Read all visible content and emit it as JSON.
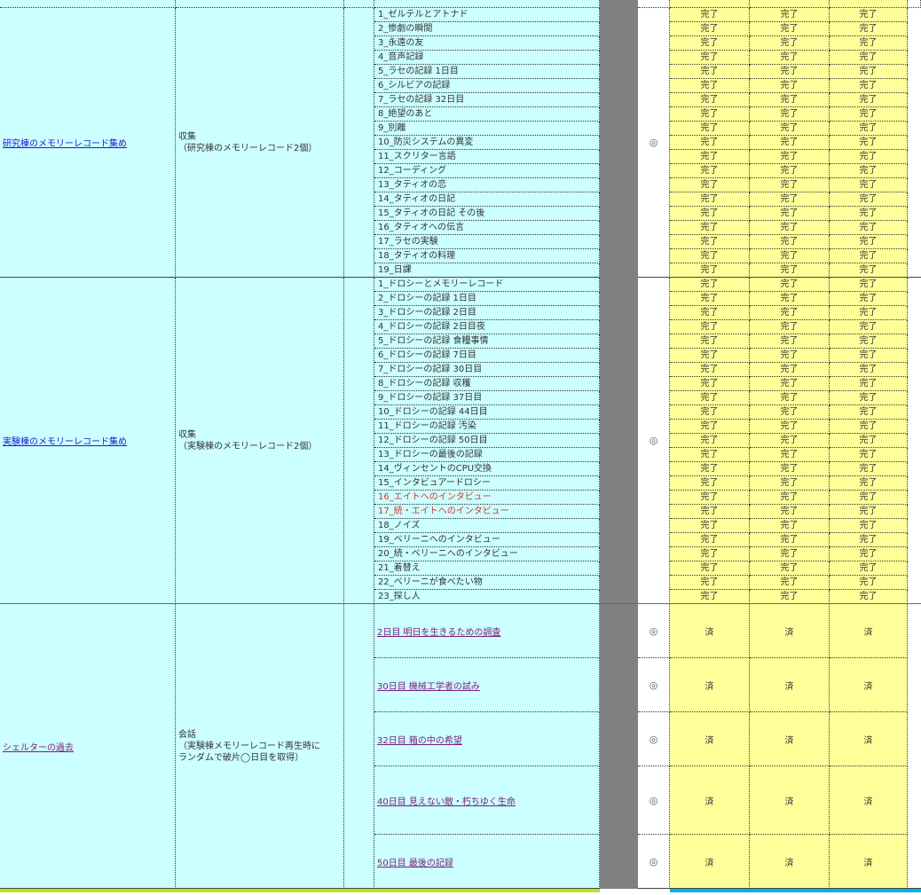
{
  "colors": {
    "cyan": "#ccffff",
    "yellow": "#ffff99",
    "grey": "#808080",
    "link_blue": "#1a1acc",
    "link_purple": "#7b1f7b",
    "highlight_red": "#d9362a",
    "bottom_lime": "#b5e61d",
    "bottom_blue": "#00b0f0",
    "section_green": "#2e8b57"
  },
  "sections": [
    {
      "category": "研究棟のメモリーレコード集め",
      "content_type": "収集\n（研究棟のメモリーレコード2個）",
      "mark": "◎",
      "items": [
        {
          "name": "1_ゼルテルとアトナド",
          "status": [
            "完了",
            "完了",
            "完了"
          ]
        },
        {
          "name": "2_惨劇の瞬間",
          "status": [
            "完了",
            "完了",
            "完了"
          ]
        },
        {
          "name": "3_永遠の友",
          "status": [
            "完了",
            "完了",
            "完了"
          ]
        },
        {
          "name": "4_音声記録",
          "status": [
            "完了",
            "完了",
            "完了"
          ]
        },
        {
          "name": "5_ラセの記録 1日目",
          "status": [
            "完了",
            "完了",
            "完了"
          ]
        },
        {
          "name": "6_シルビアの記録",
          "status": [
            "完了",
            "完了",
            "完了"
          ]
        },
        {
          "name": "7_ラセの記録 32日目",
          "status": [
            "完了",
            "完了",
            "完了"
          ]
        },
        {
          "name": "8_絶望のあと",
          "status": [
            "完了",
            "完了",
            "完了"
          ]
        },
        {
          "name": "9_別離",
          "status": [
            "完了",
            "完了",
            "完了"
          ]
        },
        {
          "name": "10_防災システムの異変",
          "status": [
            "完了",
            "完了",
            "完了"
          ]
        },
        {
          "name": "11_スクリター言語",
          "status": [
            "完了",
            "完了",
            "完了"
          ]
        },
        {
          "name": "12_コーディング",
          "status": [
            "完了",
            "完了",
            "完了"
          ]
        },
        {
          "name": "13_タティオの恋",
          "status": [
            "完了",
            "完了",
            "完了"
          ]
        },
        {
          "name": "14_タティオの日記",
          "status": [
            "完了",
            "完了",
            "完了"
          ]
        },
        {
          "name": "15_タティオの日記 その後",
          "status": [
            "完了",
            "完了",
            "完了"
          ]
        },
        {
          "name": "16_タティオへの伝言",
          "status": [
            "完了",
            "完了",
            "完了"
          ]
        },
        {
          "name": "17_ラセの実験",
          "status": [
            "完了",
            "完了",
            "完了"
          ]
        },
        {
          "name": "18_タティオの料理",
          "status": [
            "完了",
            "完了",
            "完了"
          ]
        },
        {
          "name": "19_日課",
          "status": [
            "完了",
            "完了",
            "完了"
          ]
        }
      ]
    },
    {
      "category": "実験棟のメモリーレコード集め",
      "content_type": "収集\n（実験棟のメモリーレコード2個）",
      "mark": "◎",
      "items": [
        {
          "name": "1_ドロシーとメモリーレコード",
          "status": [
            "完了",
            "完了",
            "完了"
          ]
        },
        {
          "name": "2_ドロシーの記録 1日目",
          "status": [
            "完了",
            "完了",
            "完了"
          ]
        },
        {
          "name": "3_ドロシーの記録 2日目",
          "status": [
            "完了",
            "完了",
            "完了"
          ]
        },
        {
          "name": "4_ドロシーの記録 2日目夜",
          "status": [
            "完了",
            "完了",
            "完了"
          ]
        },
        {
          "name": "5_ドロシーの記録 食糧事情",
          "status": [
            "完了",
            "完了",
            "完了"
          ]
        },
        {
          "name": "6_ドロシーの記録 7日目",
          "status": [
            "完了",
            "完了",
            "完了"
          ]
        },
        {
          "name": "7_ドロシーの記録 30日目",
          "status": [
            "完了",
            "完了",
            "完了"
          ]
        },
        {
          "name": "8_ドロシーの記録 収穫",
          "status": [
            "完了",
            "完了",
            "完了"
          ]
        },
        {
          "name": "9_ドロシーの記録 37日目",
          "status": [
            "完了",
            "完了",
            "完了"
          ]
        },
        {
          "name": "10_ドロシーの記録 44日目",
          "status": [
            "完了",
            "完了",
            "完了"
          ]
        },
        {
          "name": "11_ドロシーの記録 汚染",
          "status": [
            "完了",
            "完了",
            "完了"
          ]
        },
        {
          "name": "12_ドロシーの記録 50日目",
          "status": [
            "完了",
            "完了",
            "完了"
          ]
        },
        {
          "name": "13_ドロシーの最後の記録",
          "status": [
            "完了",
            "完了",
            "完了"
          ]
        },
        {
          "name": "14_ヴィンセントのCPU交換",
          "status": [
            "完了",
            "完了",
            "完了"
          ]
        },
        {
          "name": "15_インタビュアードロシー",
          "status": [
            "完了",
            "完了",
            "完了"
          ]
        },
        {
          "name": "16_エイトへのインタビュー",
          "status": [
            "完了",
            "完了",
            "完了"
          ],
          "highlight": true
        },
        {
          "name": "17_続・エイトへのインタビュー",
          "status": [
            "完了",
            "完了",
            "完了"
          ],
          "highlight": true
        },
        {
          "name": "18_ノイズ",
          "status": [
            "完了",
            "完了",
            "完了"
          ]
        },
        {
          "name": "19_ベリーニへのインタビュー",
          "status": [
            "完了",
            "完了",
            "完了"
          ]
        },
        {
          "name": "20_続・ベリーニへのインタビュー",
          "status": [
            "完了",
            "完了",
            "完了"
          ]
        },
        {
          "name": "21_着替え",
          "status": [
            "完了",
            "完了",
            "完了"
          ]
        },
        {
          "name": "22_ベリーニが食べたい物",
          "status": [
            "完了",
            "完了",
            "完了"
          ]
        },
        {
          "name": "23_探し人",
          "status": [
            "完了",
            "完了",
            "完了"
          ]
        }
      ]
    },
    {
      "category": "シェルターの過去",
      "content_type": "会話\n（実験棟メモリーレコード再生時に\nランダムで破片◯日目を取得）",
      "items": [
        {
          "name": "2日目 明日を生きるための調査",
          "mark": "◎",
          "status": [
            "済",
            "済",
            "済"
          ]
        },
        {
          "name": "30日目 機械工学者の試み",
          "mark": "◎",
          "status": [
            "済",
            "済",
            "済"
          ]
        },
        {
          "name": "32日目 箱の中の希望",
          "mark": "◎",
          "status": [
            "済",
            "済",
            "済"
          ]
        },
        {
          "name": "40日目 見えない敵・朽ちゆく生命",
          "mark": "◎",
          "status": [
            "済",
            "済",
            "済"
          ]
        },
        {
          "name": "50日目 最後の記録",
          "mark": "◎",
          "status": [
            "済",
            "済",
            "済"
          ]
        }
      ]
    }
  ]
}
